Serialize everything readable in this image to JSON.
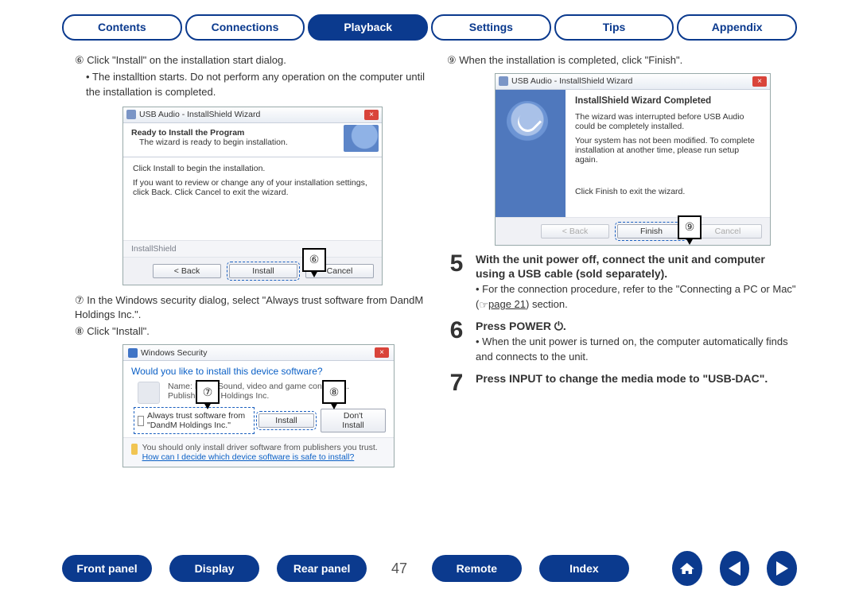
{
  "nav": {
    "contents": "Contents",
    "connections": "Connections",
    "playback": "Playback",
    "settings": "Settings",
    "tips": "Tips",
    "appendix": "Appendix",
    "active": "playback"
  },
  "left": {
    "step6_num": "⑥",
    "step6": "Click \"Install\" on the  installation start dialog.",
    "step6_sub": "The installtion starts. Do not perform any operation on the computer until the installation is completed.",
    "wizard1": {
      "title": "USB Audio - InstallShield Wizard",
      "banner_h": "Ready to Install the Program",
      "banner_sub": "The wizard is ready to begin installation.",
      "body_l1": "Click Install to begin the installation.",
      "body_l2": "If you want to review or change any of your installation settings, click Back. Click Cancel to exit the wizard.",
      "status": "InstallShield",
      "back": "< Back",
      "install": "Install",
      "cancel": "Cancel",
      "callout": "⑥"
    },
    "step7_num": "⑦",
    "step7": "In the Windows security dialog, select \"Always trust software from DandM Holdings Inc.\".",
    "step8_num": "⑧",
    "step8": "Click \"Install\".",
    "security": {
      "title": "Windows Security",
      "question": "Would you like to install this device software?",
      "name_label": "Name: M",
      "cat": "Sound, video and game controller...",
      "pub_label": "Publishe",
      "pub_val": "M Holdings Inc.",
      "check": "Always trust software from \"DandM Holdings Inc.\"",
      "install": "Install",
      "dont": "Don't Install",
      "advice1": "You should only install driver software from publishers you trust.",
      "advice2_link": "How can I decide which device software is safe to install?",
      "callout7": "⑦",
      "callout8": "⑧"
    }
  },
  "right": {
    "step9_num": "⑨",
    "step9": "When the installation is completed, click \"Finish\".",
    "finish": {
      "title": "USB Audio - InstallShield Wizard",
      "header": "InstallShield Wizard Completed",
      "p1": "The wizard was interrupted before USB Audio could be completely installed.",
      "p2": "Your system has not been modified. To complete installation at another time, please run setup again.",
      "p3": "Click Finish to exit the wizard.",
      "back": "< Back",
      "finishbtn": "Finish",
      "cancel": "Cancel",
      "callout": "⑨"
    },
    "r5": {
      "n": "5",
      "head": "With the unit power off, connect the unit and computer using a USB cable (sold separately).",
      "body_pre": "For the connection procedure, refer to the \"Connecting a PC or Mac\" (",
      "body_link": "page 21",
      "body_post": ") section."
    },
    "r6": {
      "n": "6",
      "head_pre": "Press POWER ",
      "head_icon": "⏻",
      "head_post": ".",
      "body": "When the unit power is turned on, the computer automatically finds and connects to the unit."
    },
    "r7": {
      "n": "7",
      "head": "Press INPUT to change the media mode to \"USB-DAC\"."
    }
  },
  "bottom": {
    "front": "Front panel",
    "display": "Display",
    "rear": "Rear panel",
    "page": "47",
    "remote": "Remote",
    "index": "Index"
  }
}
